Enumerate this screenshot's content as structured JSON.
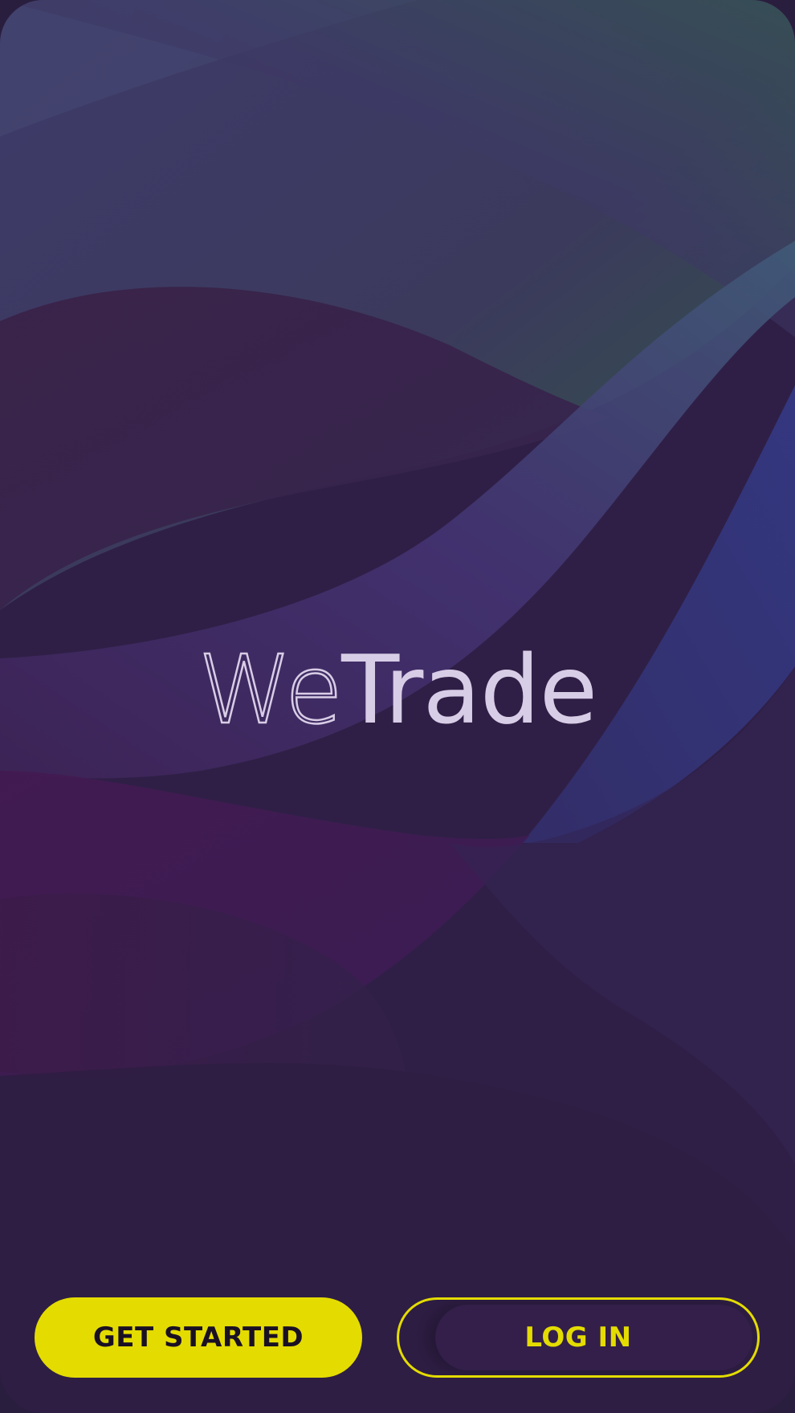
{
  "app": {
    "logo": {
      "part1": "We",
      "part2": "Trade"
    }
  },
  "actions": {
    "get_started_label": "GET STARTED",
    "login_label": "LOG IN"
  },
  "colors": {
    "accent": "#e4dc00",
    "background": "#2f1f46",
    "logo_text": "#d8cde6"
  }
}
